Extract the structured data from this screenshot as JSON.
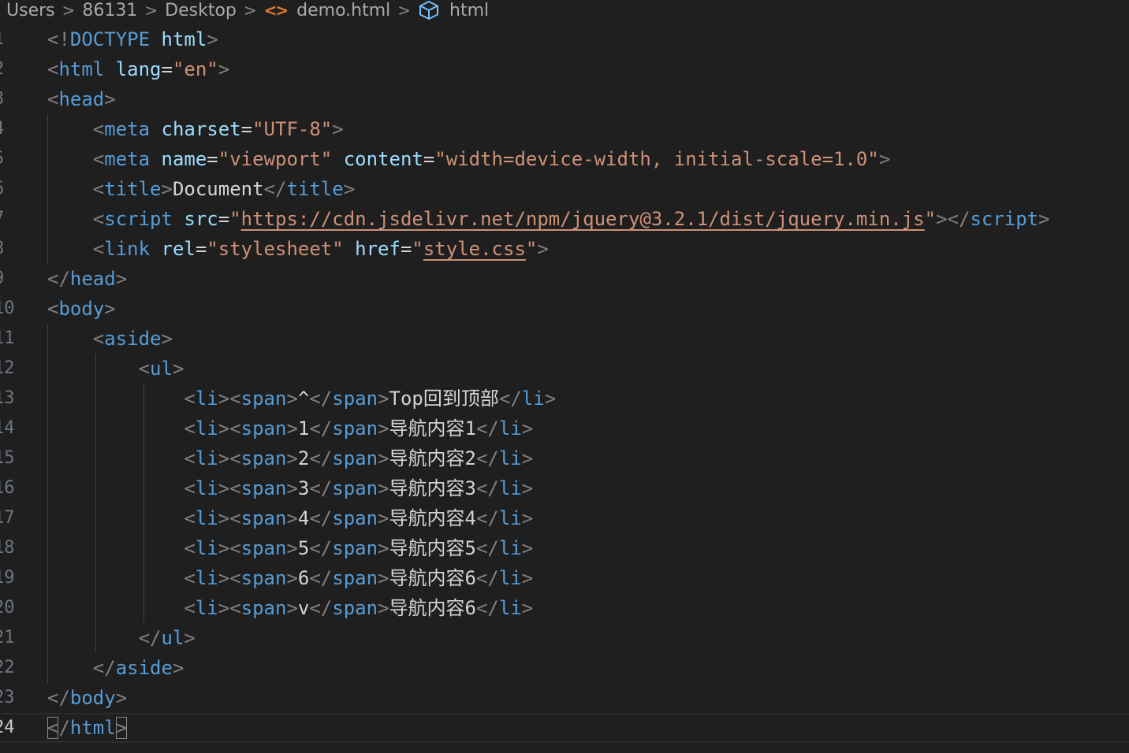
{
  "breadcrumb": {
    "items": [
      {
        "label": "Users"
      },
      {
        "label": "86131"
      },
      {
        "label": "Desktop"
      },
      {
        "label": "demo.html",
        "icon": "code-icon"
      },
      {
        "label": "html",
        "icon": "cube-icon"
      }
    ]
  },
  "colors": {
    "background": "#1f1f1f",
    "tag": "#569cd6",
    "attribute": "#9cdcfe",
    "string": "#ce9178",
    "punctuation": "#808080",
    "text": "#d4d4d4",
    "line_number": "#6e7681"
  },
  "editor": {
    "current_line": 24,
    "lines": [
      {
        "number": "1",
        "tokens": [
          [
            "punct",
            "<!"
          ],
          [
            "tag",
            "DOCTYPE"
          ],
          [
            "text",
            " "
          ],
          [
            "attr",
            "html"
          ],
          [
            "punct",
            ">"
          ]
        ]
      },
      {
        "number": "2",
        "tokens": [
          [
            "punct",
            "<"
          ],
          [
            "tag",
            "html"
          ],
          [
            "text",
            " "
          ],
          [
            "attr",
            "lang"
          ],
          [
            "eq",
            "="
          ],
          [
            "str",
            "\"en\""
          ],
          [
            "punct",
            ">"
          ]
        ]
      },
      {
        "number": "3",
        "tokens": [
          [
            "punct",
            "<"
          ],
          [
            "tag",
            "head"
          ],
          [
            "punct",
            ">"
          ]
        ]
      },
      {
        "number": "4",
        "tokens": [
          [
            "text",
            "    "
          ],
          [
            "punct",
            "<"
          ],
          [
            "tag",
            "meta"
          ],
          [
            "text",
            " "
          ],
          [
            "attr",
            "charset"
          ],
          [
            "eq",
            "="
          ],
          [
            "str",
            "\"UTF-8\""
          ],
          [
            "punct",
            ">"
          ]
        ]
      },
      {
        "number": "5",
        "tokens": [
          [
            "text",
            "    "
          ],
          [
            "punct",
            "<"
          ],
          [
            "tag",
            "meta"
          ],
          [
            "text",
            " "
          ],
          [
            "attr",
            "name"
          ],
          [
            "eq",
            "="
          ],
          [
            "str",
            "\"viewport\""
          ],
          [
            "text",
            " "
          ],
          [
            "attr",
            "content"
          ],
          [
            "eq",
            "="
          ],
          [
            "str",
            "\"width=device-width, initial-scale=1.0\""
          ],
          [
            "punct",
            ">"
          ]
        ]
      },
      {
        "number": "6",
        "tokens": [
          [
            "text",
            "    "
          ],
          [
            "punct",
            "<"
          ],
          [
            "tag",
            "title"
          ],
          [
            "punct",
            ">"
          ],
          [
            "text",
            "Document"
          ],
          [
            "punct",
            "</"
          ],
          [
            "tag",
            "title"
          ],
          [
            "punct",
            ">"
          ]
        ]
      },
      {
        "number": "7",
        "tokens": [
          [
            "text",
            "    "
          ],
          [
            "punct",
            "<"
          ],
          [
            "tag",
            "script"
          ],
          [
            "text",
            " "
          ],
          [
            "attr",
            "src"
          ],
          [
            "eq",
            "="
          ],
          [
            "str",
            "\""
          ],
          [
            "link",
            "https://cdn.jsdelivr.net/npm/jquery@3.2.1/dist/jquery.min.js"
          ],
          [
            "str",
            "\""
          ],
          [
            "punct",
            "></"
          ],
          [
            "tag",
            "script"
          ],
          [
            "punct",
            ">"
          ]
        ]
      },
      {
        "number": "8",
        "tokens": [
          [
            "text",
            "    "
          ],
          [
            "punct",
            "<"
          ],
          [
            "tag",
            "link"
          ],
          [
            "text",
            " "
          ],
          [
            "attr",
            "rel"
          ],
          [
            "eq",
            "="
          ],
          [
            "str",
            "\"stylesheet\""
          ],
          [
            "text",
            " "
          ],
          [
            "attr",
            "href"
          ],
          [
            "eq",
            "="
          ],
          [
            "str",
            "\""
          ],
          [
            "link",
            "style.css"
          ],
          [
            "str",
            "\""
          ],
          [
            "punct",
            ">"
          ]
        ]
      },
      {
        "number": "9",
        "tokens": [
          [
            "punct",
            "</"
          ],
          [
            "tag",
            "head"
          ],
          [
            "punct",
            ">"
          ]
        ]
      },
      {
        "number": "10",
        "tokens": [
          [
            "punct",
            "<"
          ],
          [
            "tag",
            "body"
          ],
          [
            "punct",
            ">"
          ]
        ]
      },
      {
        "number": "11",
        "tokens": [
          [
            "text",
            "    "
          ],
          [
            "punct",
            "<"
          ],
          [
            "tag",
            "aside"
          ],
          [
            "punct",
            ">"
          ]
        ]
      },
      {
        "number": "12",
        "tokens": [
          [
            "text",
            "        "
          ],
          [
            "punct",
            "<"
          ],
          [
            "tag",
            "ul"
          ],
          [
            "punct",
            ">"
          ]
        ]
      },
      {
        "number": "13",
        "tokens": [
          [
            "text",
            "            "
          ],
          [
            "punct",
            "<"
          ],
          [
            "tag",
            "li"
          ],
          [
            "punct",
            "><"
          ],
          [
            "tag",
            "span"
          ],
          [
            "punct",
            ">"
          ],
          [
            "text",
            "^"
          ],
          [
            "punct",
            "</"
          ],
          [
            "tag",
            "span"
          ],
          [
            "punct",
            ">"
          ],
          [
            "text",
            "Top回到顶部"
          ],
          [
            "punct",
            "</"
          ],
          [
            "tag",
            "li"
          ],
          [
            "punct",
            ">"
          ]
        ]
      },
      {
        "number": "14",
        "tokens": [
          [
            "text",
            "            "
          ],
          [
            "punct",
            "<"
          ],
          [
            "tag",
            "li"
          ],
          [
            "punct",
            "><"
          ],
          [
            "tag",
            "span"
          ],
          [
            "punct",
            ">"
          ],
          [
            "text",
            "1"
          ],
          [
            "punct",
            "</"
          ],
          [
            "tag",
            "span"
          ],
          [
            "punct",
            ">"
          ],
          [
            "text",
            "导航内容1"
          ],
          [
            "punct",
            "</"
          ],
          [
            "tag",
            "li"
          ],
          [
            "punct",
            ">"
          ]
        ]
      },
      {
        "number": "15",
        "tokens": [
          [
            "text",
            "            "
          ],
          [
            "punct",
            "<"
          ],
          [
            "tag",
            "li"
          ],
          [
            "punct",
            "><"
          ],
          [
            "tag",
            "span"
          ],
          [
            "punct",
            ">"
          ],
          [
            "text",
            "2"
          ],
          [
            "punct",
            "</"
          ],
          [
            "tag",
            "span"
          ],
          [
            "punct",
            ">"
          ],
          [
            "text",
            "导航内容2"
          ],
          [
            "punct",
            "</"
          ],
          [
            "tag",
            "li"
          ],
          [
            "punct",
            ">"
          ]
        ]
      },
      {
        "number": "16",
        "tokens": [
          [
            "text",
            "            "
          ],
          [
            "punct",
            "<"
          ],
          [
            "tag",
            "li"
          ],
          [
            "punct",
            "><"
          ],
          [
            "tag",
            "span"
          ],
          [
            "punct",
            ">"
          ],
          [
            "text",
            "3"
          ],
          [
            "punct",
            "</"
          ],
          [
            "tag",
            "span"
          ],
          [
            "punct",
            ">"
          ],
          [
            "text",
            "导航内容3"
          ],
          [
            "punct",
            "</"
          ],
          [
            "tag",
            "li"
          ],
          [
            "punct",
            ">"
          ]
        ]
      },
      {
        "number": "17",
        "tokens": [
          [
            "text",
            "            "
          ],
          [
            "punct",
            "<"
          ],
          [
            "tag",
            "li"
          ],
          [
            "punct",
            "><"
          ],
          [
            "tag",
            "span"
          ],
          [
            "punct",
            ">"
          ],
          [
            "text",
            "4"
          ],
          [
            "punct",
            "</"
          ],
          [
            "tag",
            "span"
          ],
          [
            "punct",
            ">"
          ],
          [
            "text",
            "导航内容4"
          ],
          [
            "punct",
            "</"
          ],
          [
            "tag",
            "li"
          ],
          [
            "punct",
            ">"
          ]
        ]
      },
      {
        "number": "18",
        "tokens": [
          [
            "text",
            "            "
          ],
          [
            "punct",
            "<"
          ],
          [
            "tag",
            "li"
          ],
          [
            "punct",
            "><"
          ],
          [
            "tag",
            "span"
          ],
          [
            "punct",
            ">"
          ],
          [
            "text",
            "5"
          ],
          [
            "punct",
            "</"
          ],
          [
            "tag",
            "span"
          ],
          [
            "punct",
            ">"
          ],
          [
            "text",
            "导航内容5"
          ],
          [
            "punct",
            "</"
          ],
          [
            "tag",
            "li"
          ],
          [
            "punct",
            ">"
          ]
        ]
      },
      {
        "number": "19",
        "tokens": [
          [
            "text",
            "            "
          ],
          [
            "punct",
            "<"
          ],
          [
            "tag",
            "li"
          ],
          [
            "punct",
            "><"
          ],
          [
            "tag",
            "span"
          ],
          [
            "punct",
            ">"
          ],
          [
            "text",
            "6"
          ],
          [
            "punct",
            "</"
          ],
          [
            "tag",
            "span"
          ],
          [
            "punct",
            ">"
          ],
          [
            "text",
            "导航内容6"
          ],
          [
            "punct",
            "</"
          ],
          [
            "tag",
            "li"
          ],
          [
            "punct",
            ">"
          ]
        ]
      },
      {
        "number": "20",
        "tokens": [
          [
            "text",
            "            "
          ],
          [
            "punct",
            "<"
          ],
          [
            "tag",
            "li"
          ],
          [
            "punct",
            "><"
          ],
          [
            "tag",
            "span"
          ],
          [
            "punct",
            ">"
          ],
          [
            "text",
            "v"
          ],
          [
            "punct",
            "</"
          ],
          [
            "tag",
            "span"
          ],
          [
            "punct",
            ">"
          ],
          [
            "text",
            "导航内容6"
          ],
          [
            "punct",
            "</"
          ],
          [
            "tag",
            "li"
          ],
          [
            "punct",
            ">"
          ]
        ]
      },
      {
        "number": "21",
        "tokens": [
          [
            "text",
            "        "
          ],
          [
            "punct",
            "</"
          ],
          [
            "tag",
            "ul"
          ],
          [
            "punct",
            ">"
          ]
        ]
      },
      {
        "number": "22",
        "tokens": [
          [
            "text",
            "    "
          ],
          [
            "punct",
            "</"
          ],
          [
            "tag",
            "aside"
          ],
          [
            "punct",
            ">"
          ]
        ]
      },
      {
        "number": "23",
        "tokens": [
          [
            "punct",
            "</"
          ],
          [
            "tag",
            "body"
          ],
          [
            "punct",
            ">"
          ]
        ]
      },
      {
        "number": "24",
        "tokens": [
          [
            "bracket",
            "<"
          ],
          [
            "punct",
            "/"
          ],
          [
            "tag",
            "html"
          ],
          [
            "bracket",
            ">"
          ]
        ]
      }
    ]
  }
}
